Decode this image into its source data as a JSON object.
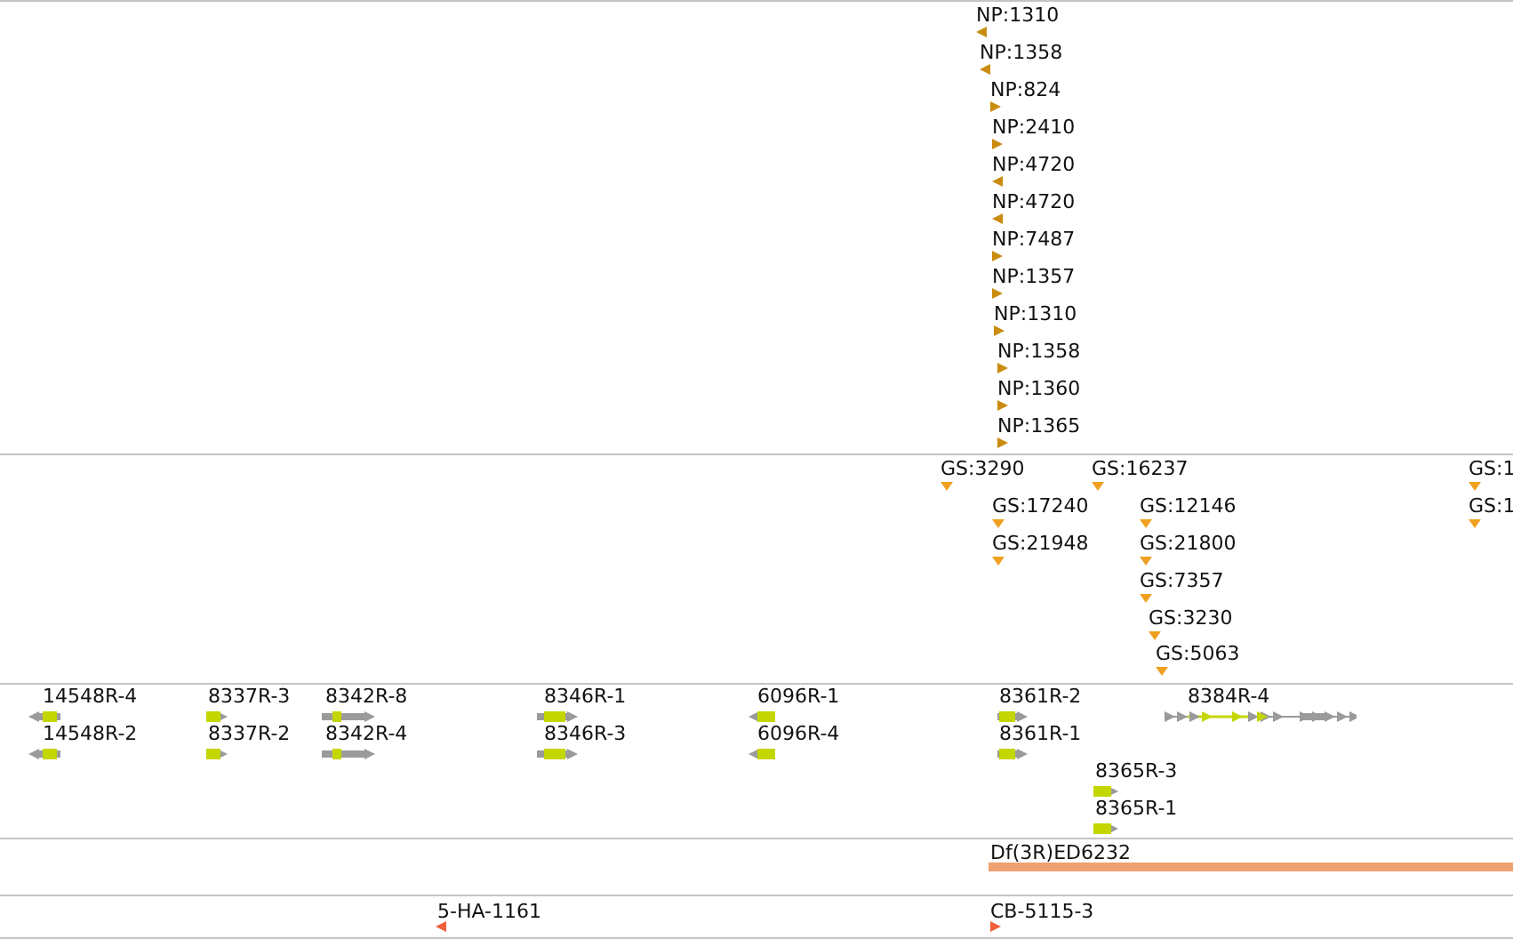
{
  "np_track": {
    "features": [
      {
        "label": "NP:1310",
        "forward": false
      },
      {
        "label": "NP:1358",
        "forward": false
      },
      {
        "label": "NP:824",
        "forward": true
      },
      {
        "label": "NP:2410",
        "forward": true
      },
      {
        "label": "NP:4720",
        "forward": false
      },
      {
        "label": "NP:4720",
        "forward": false
      },
      {
        "label": "NP:7487",
        "forward": true
      },
      {
        "label": "NP:1357",
        "forward": true
      },
      {
        "label": "NP:1310",
        "forward": true
      },
      {
        "label": "NP:1358",
        "forward": true
      },
      {
        "label": "NP:1360",
        "forward": true
      },
      {
        "label": "NP:1365",
        "forward": true
      }
    ]
  },
  "gs_track": {
    "features": [
      {
        "label": "GS:3290"
      },
      {
        "label": "GS:16237"
      },
      {
        "label": "GS:17240"
      },
      {
        "label": "GS:12146"
      },
      {
        "label": "GS:21948"
      },
      {
        "label": "GS:21800"
      },
      {
        "label": "GS:7357"
      },
      {
        "label": "GS:3230"
      },
      {
        "label": "GS:5063"
      },
      {
        "label": "GS:1"
      },
      {
        "label": "GS:1"
      }
    ]
  },
  "gene_track": {
    "features": [
      {
        "label": "14548R-4",
        "forward": false,
        "kind": "simple"
      },
      {
        "label": "14548R-2",
        "forward": false,
        "kind": "simple"
      },
      {
        "label": "8337R-3",
        "forward": true,
        "kind": "simple"
      },
      {
        "label": "8337R-2",
        "forward": true,
        "kind": "simple"
      },
      {
        "label": "8342R-8",
        "forward": true,
        "kind": "simple"
      },
      {
        "label": "8342R-4",
        "forward": true,
        "kind": "simple"
      },
      {
        "label": "8346R-1",
        "forward": true,
        "kind": "simple"
      },
      {
        "label": "8346R-3",
        "forward": true,
        "kind": "simple"
      },
      {
        "label": "6096R-1",
        "forward": false,
        "kind": "simple"
      },
      {
        "label": "6096R-4",
        "forward": false,
        "kind": "simple"
      },
      {
        "label": "8361R-2",
        "forward": true,
        "kind": "simple"
      },
      {
        "label": "8361R-1",
        "forward": true,
        "kind": "simple"
      },
      {
        "label": "8384R-4",
        "forward": true,
        "kind": "multi"
      },
      {
        "label": "8365R-3",
        "forward": true,
        "kind": "simple"
      },
      {
        "label": "8365R-1",
        "forward": true,
        "kind": "simple"
      }
    ]
  },
  "deficiency_track": {
    "features": [
      {
        "label": "Df(3R)ED6232"
      }
    ]
  },
  "insertion_track": {
    "features": [
      {
        "label": "5-HA-1161",
        "forward": false
      },
      {
        "label": "CB-5115-3",
        "forward": true
      }
    ]
  }
}
